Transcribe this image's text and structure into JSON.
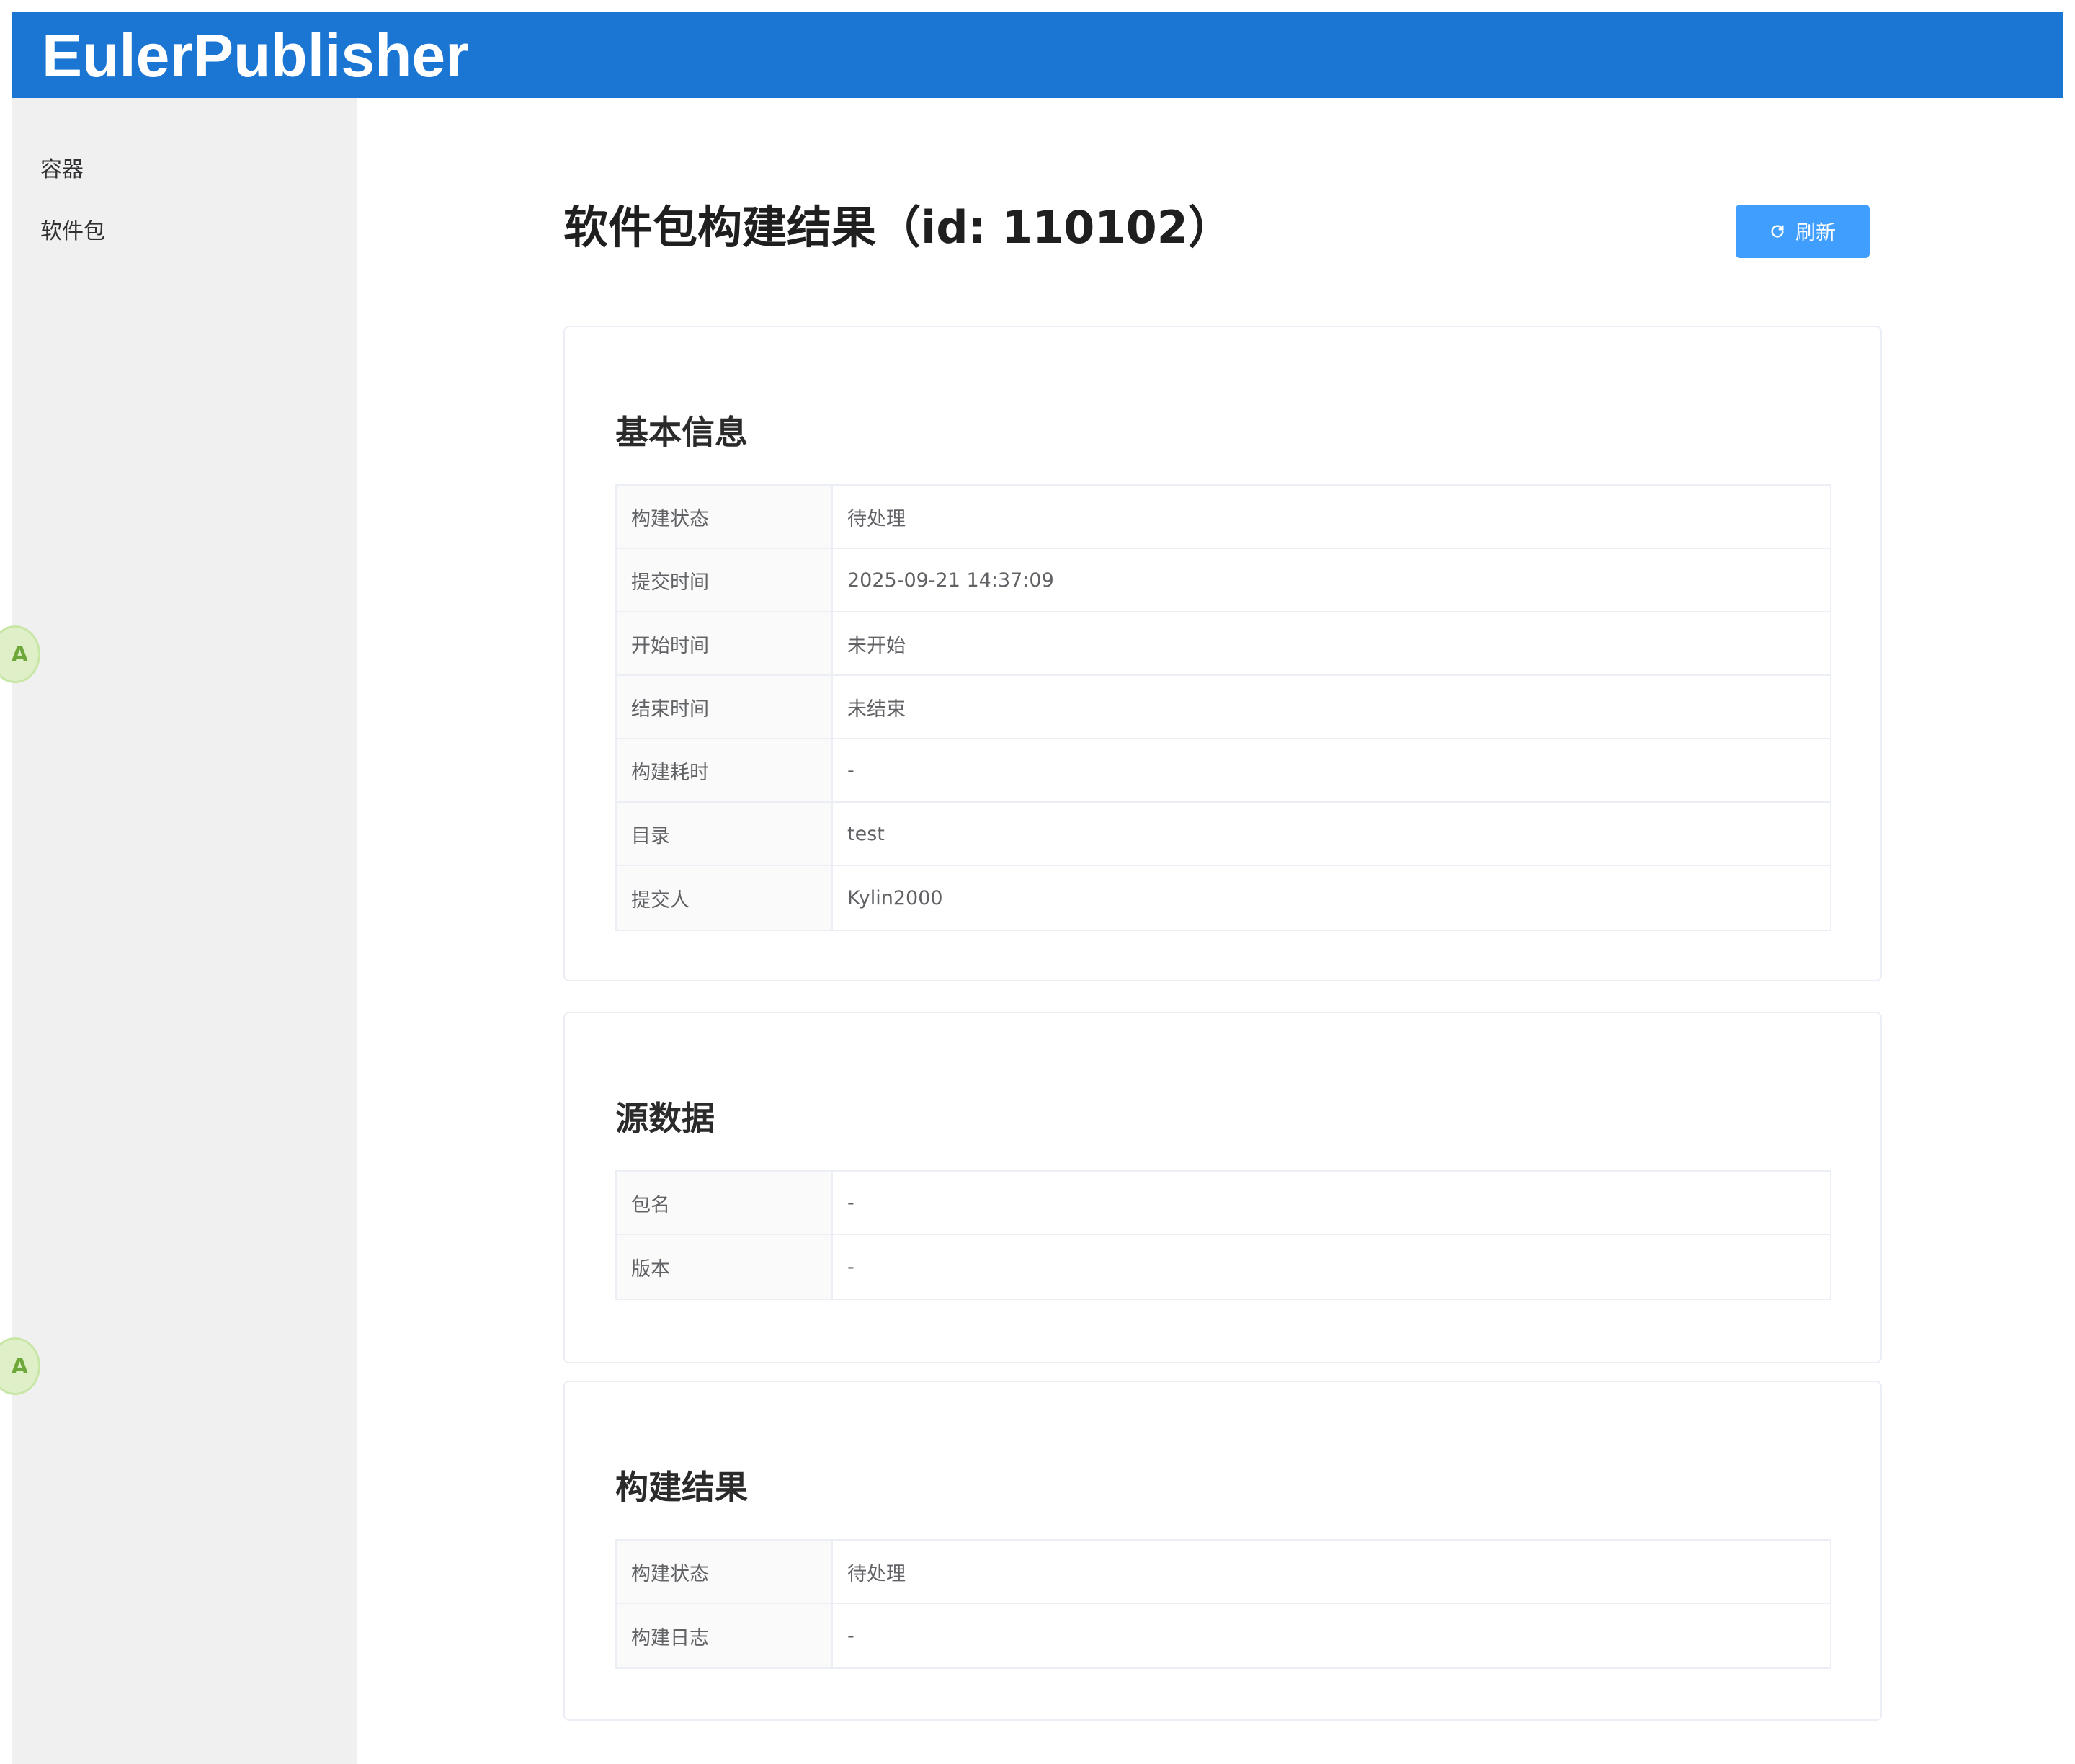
{
  "header": {
    "brand": "EulerPublisher"
  },
  "sidebar": {
    "items": [
      {
        "label": "容器"
      },
      {
        "label": "软件包"
      }
    ]
  },
  "page": {
    "title": "软件包构建结果（id: 110102）",
    "refresh_label": "刷新"
  },
  "sections": {
    "basic": {
      "title": "基本信息",
      "rows": [
        {
          "label": "构建状态",
          "value": "待处理"
        },
        {
          "label": "提交时间",
          "value": "2025-09-21 14:37:09"
        },
        {
          "label": "开始时间",
          "value": "未开始"
        },
        {
          "label": "结束时间",
          "value": "未结束"
        },
        {
          "label": "构建耗时",
          "value": "-"
        },
        {
          "label": "目录",
          "value": "test"
        },
        {
          "label": "提交人",
          "value": "Kylin2000"
        }
      ]
    },
    "source": {
      "title": "源数据",
      "rows": [
        {
          "label": "包名",
          "value": "-"
        },
        {
          "label": "版本",
          "value": "-"
        }
      ]
    },
    "result": {
      "title": "构建结果",
      "rows": [
        {
          "label": "构建状态",
          "value": "待处理"
        },
        {
          "label": "构建日志",
          "value": "-"
        }
      ]
    }
  },
  "colors": {
    "header_bg": "#1b76d3",
    "button_bg": "#409eff",
    "sidebar_bg": "#f0f0f0"
  },
  "icons": {
    "refresh": "refresh-icon",
    "translate": "translate-icon"
  }
}
